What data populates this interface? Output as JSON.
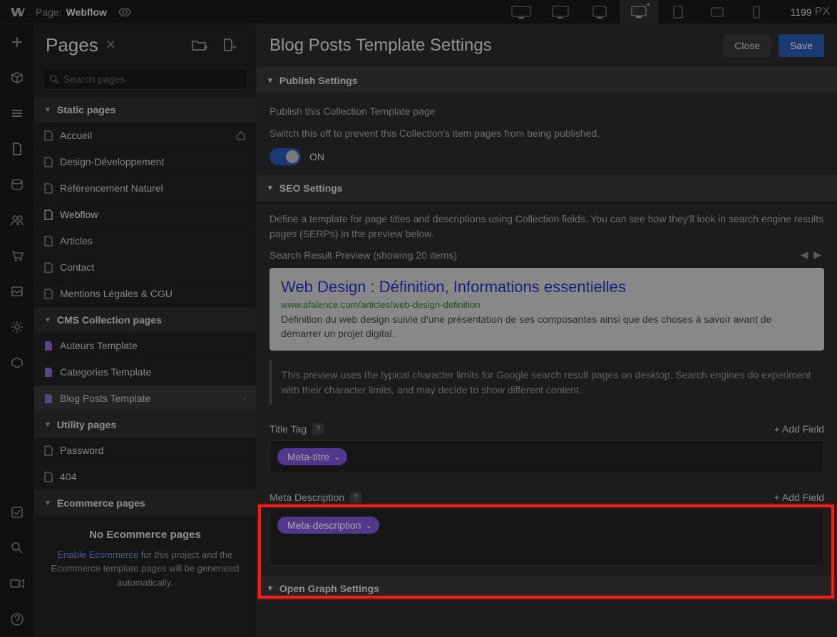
{
  "topbar": {
    "page_label": "Page:",
    "page_name": "Webflow",
    "width": "1199",
    "width_unit": "PX"
  },
  "pages_panel": {
    "title": "Pages",
    "search_placeholder": "Search pages",
    "sections": {
      "static": "Static pages",
      "cms": "CMS Collection pages",
      "utility": "Utility pages",
      "ecom": "Ecommerce pages"
    },
    "static_items": [
      "Accueil",
      "Design-Développement",
      "Référencement Naturel",
      "Webflow",
      "Articles",
      "Contact",
      "Mentions Légales & CGU"
    ],
    "cms_items": [
      "Auteurs Template",
      "Categories Template",
      "Blog Posts Template"
    ],
    "utility_items": [
      "Password",
      "404"
    ],
    "no_ecom": {
      "title": "No Ecommerce pages",
      "link": "Enable Ecommerce",
      "rest": " for this project and the Ecommerce template pages will be generated automatically."
    }
  },
  "settings": {
    "title": "Blog Posts Template Settings",
    "close": "Close",
    "save": "Save",
    "publish": {
      "header": "Publish Settings",
      "line1": "Publish this Collection Template page",
      "line2": "Switch this off to prevent this Collection's item pages from being published.",
      "toggle_label": "ON"
    },
    "seo": {
      "header": "SEO Settings",
      "intro": "Define a template for page titles and descriptions using Collection fields. You can see how they'll look in search engine results pages (SERPs) in the preview below.",
      "preview_label": "Search Result Preview (showing 20 items)",
      "serp_title": "Web Design : Définition, Informations essentielles",
      "serp_url": "www.afalence.com/articles/web-design-definition",
      "serp_desc": "Définition du web design suivie d'une présentation de ses composantes ainsi que des choses à savoir avant de démarrer un projet digital.",
      "serp_note": "This preview uses the typical character limits for Google search result pages on desktop. Search engines do experiment with their character limits, and may decide to show different content.",
      "title_tag": "Title Tag",
      "add_field": "+ Add Field",
      "title_chip": "Meta-titre",
      "meta_desc": "Meta Description",
      "meta_chip": "Meta-description"
    },
    "og": {
      "header": "Open Graph Settings"
    }
  }
}
